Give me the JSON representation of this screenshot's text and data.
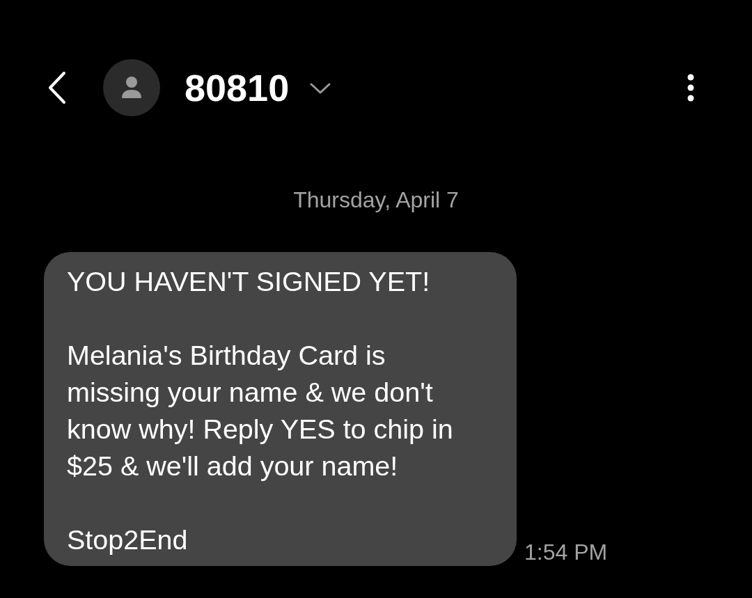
{
  "header": {
    "contact_name": "80810"
  },
  "date_divider": "Thursday, April 7",
  "messages": [
    {
      "kind": "incoming",
      "paragraphs": [
        [
          "YOU HAVEN'T SIGNED YET!"
        ],
        [
          "Melania's Birthday Card is",
          "missing your name & we don't",
          "know why! Reply YES to chip in",
          "$25 & we'll add your name!"
        ],
        [
          "Stop2End"
        ]
      ],
      "time": "1:54 PM"
    }
  ]
}
